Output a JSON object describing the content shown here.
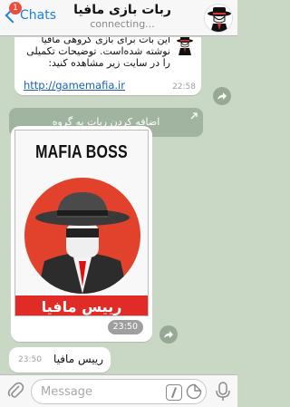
{
  "header": {
    "back_label": "Chats",
    "badge_count": "1",
    "title": "ربات بازی مافیا",
    "status": "connecting..."
  },
  "messages": {
    "intro": {
      "text": "این بات برای بازی گروهی مافیا نوشته شده‌است. توضیحات تکمیلی را در سایت زیر مشاهده کنید:",
      "link": "http://gamemafia.ir",
      "time": "22:58"
    },
    "keyboard_button": "اضافه کردن ربات به گروه",
    "photo": {
      "title": "MAFIA BOSS",
      "caption": "رییس مافیا",
      "time": "23:50"
    },
    "reply": {
      "text": "رییس مافیا",
      "time": "23:50"
    }
  },
  "input": {
    "placeholder": "Message"
  },
  "colors": {
    "accent": "#1a82e2",
    "badge": "#e94f3d",
    "chat_bg": "#c9d8c4",
    "banner_red": "#e02b26"
  },
  "icons": [
    "back-chevron-icon",
    "share-icon",
    "arrow-up-right-icon",
    "chevron-down-icon",
    "paperclip-icon",
    "slash-command-icon",
    "sticker-icon",
    "microphone-icon"
  ]
}
